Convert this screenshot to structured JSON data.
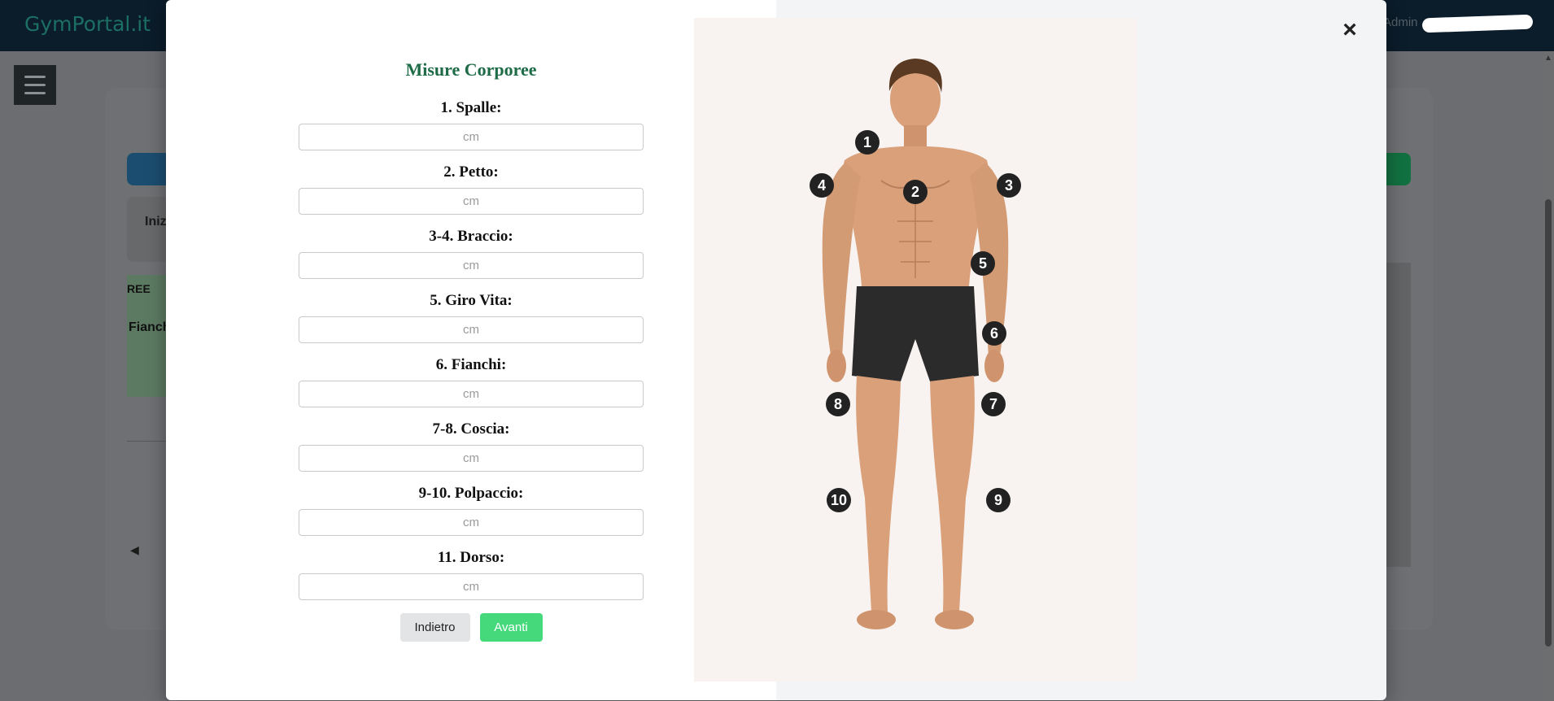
{
  "app": {
    "brand": "GymPortal.it",
    "user": "Admin"
  },
  "background": {
    "tab_label": "Iniz",
    "table_header": "REE",
    "table_cell": "Fianch"
  },
  "modal": {
    "title": "Misure Corporee",
    "placeholder": "cm",
    "fields": [
      {
        "label": "1. Spalle:",
        "value": ""
      },
      {
        "label": "2. Petto:",
        "value": ""
      },
      {
        "label": "3-4. Braccio:",
        "value": ""
      },
      {
        "label": "5. Giro Vita:",
        "value": ""
      },
      {
        "label": "6. Fianchi:",
        "value": ""
      },
      {
        "label": "7-8. Coscia:",
        "value": ""
      },
      {
        "label": "9-10. Polpaccio:",
        "value": ""
      },
      {
        "label": "11. Dorso:",
        "value": ""
      }
    ],
    "back_label": "Indietro",
    "next_label": "Avanti",
    "close_icon": "×"
  },
  "illustration": {
    "markers": [
      "1",
      "2",
      "3",
      "4",
      "5",
      "6",
      "7",
      "8",
      "9",
      "10"
    ]
  },
  "colors": {
    "title_green": "#1d6b47",
    "next_button": "#45d97c",
    "back_button": "#e3e4e6",
    "marker": "#222222",
    "skin": "#d9a07a",
    "shorts": "#2b2b2b"
  }
}
